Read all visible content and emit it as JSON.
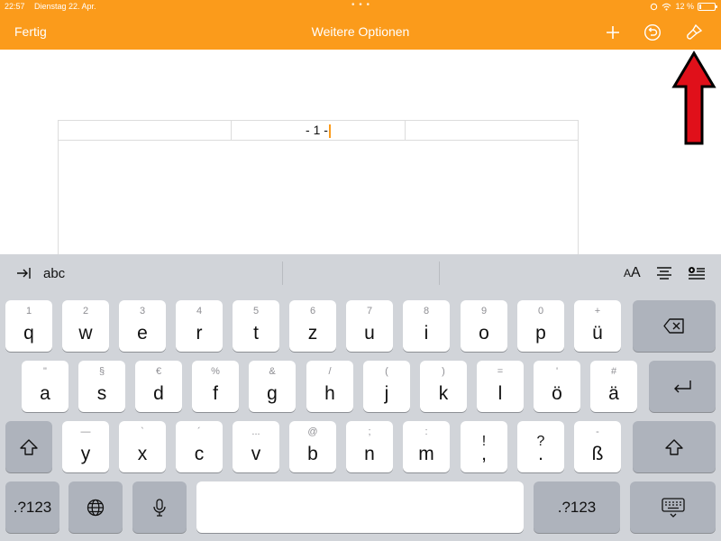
{
  "status": {
    "time": "22:57",
    "date": "Dienstag 22. Apr.",
    "battery": "12 %"
  },
  "nav": {
    "left_label": "Fertig",
    "title": "Weitere Optionen"
  },
  "document": {
    "header_cells": [
      "",
      "- 1 -",
      ""
    ]
  },
  "shortcut_bar": {
    "style_label": "abc",
    "font_size_label": "AA"
  },
  "keyboard": {
    "row1": [
      {
        "alt": "1",
        "main": "q"
      },
      {
        "alt": "2",
        "main": "w"
      },
      {
        "alt": "3",
        "main": "e"
      },
      {
        "alt": "4",
        "main": "r"
      },
      {
        "alt": "5",
        "main": "t"
      },
      {
        "alt": "6",
        "main": "z"
      },
      {
        "alt": "7",
        "main": "u"
      },
      {
        "alt": "8",
        "main": "i"
      },
      {
        "alt": "9",
        "main": "o"
      },
      {
        "alt": "0",
        "main": "p"
      },
      {
        "alt": "+",
        "main": "ü"
      }
    ],
    "row2": [
      {
        "alt": "\"",
        "main": "a"
      },
      {
        "alt": "§",
        "main": "s"
      },
      {
        "alt": "€",
        "main": "d"
      },
      {
        "alt": "%",
        "main": "f"
      },
      {
        "alt": "&",
        "main": "g"
      },
      {
        "alt": "/",
        "main": "h"
      },
      {
        "alt": "(",
        "main": "j"
      },
      {
        "alt": ")",
        "main": "k"
      },
      {
        "alt": "=",
        "main": "l"
      },
      {
        "alt": "'",
        "main": "ö"
      },
      {
        "alt": "#",
        "main": "ä"
      }
    ],
    "row3": [
      {
        "alt": "—",
        "main": "y"
      },
      {
        "alt": "`",
        "main": "x"
      },
      {
        "alt": "´",
        "main": "c"
      },
      {
        "alt": "...",
        "main": "v"
      },
      {
        "alt": "@",
        "main": "b"
      },
      {
        "alt": ";",
        "main": "n"
      },
      {
        "alt": ":",
        "main": "m"
      },
      {
        "alt": "!",
        "main": ","
      },
      {
        "alt": "?",
        "main": "."
      },
      {
        "alt": "-",
        "main": "ß"
      }
    ],
    "numbers_label": ".?123"
  },
  "colors": {
    "accent": "#fb9b1b",
    "annotation": "#e0101a",
    "keyboard_bg": "#d1d4d9"
  }
}
